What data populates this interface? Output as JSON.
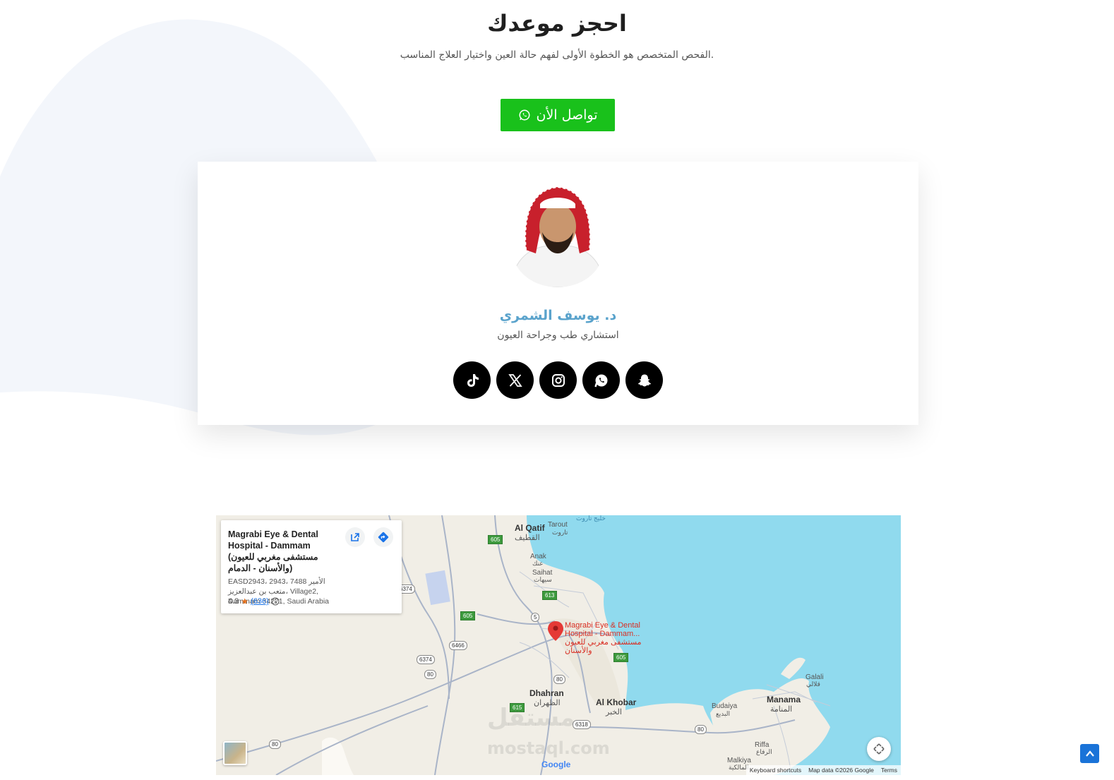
{
  "booking": {
    "title": "احجز موعدك",
    "subtitle": ".الفحص المتخصص هو الخطوة الأولى لفهم حالة العين واختيار العلاج المناسب",
    "cta_label": "تواصل الأن"
  },
  "doctor": {
    "name": "د. يوسف الشمري",
    "specialty": "استشاري طب وجراحة العيون",
    "socials": [
      {
        "icon": "tiktok-icon"
      },
      {
        "icon": "x-icon"
      },
      {
        "icon": "instagram-icon"
      },
      {
        "icon": "whatsapp-icon"
      },
      {
        "icon": "snapchat-icon"
      }
    ]
  },
  "map": {
    "place_card": {
      "name": "Magrabi Eye & Dental Hospital - Dammam (مستشفى مغربي للعيون والأسنان - الدمام)",
      "address": "EASD2943، 2943، 7488 الأمير متعب بن عبدالعزيز، Village2, Dammam 34271, Saudi Arabia",
      "rating": "4.3",
      "reviews": "(636)"
    },
    "pin_label": "Magrabi Eye & Dental Hospital - Dammam... مستشفى مغربي للعيون والأسنان",
    "labels": {
      "al_qatif": "Al Qatif",
      "al_qatif_ar": "القطيف",
      "tarout": "Tarout",
      "tarout_ar": "تاروت",
      "tarout_bay_ar": "خليج تاروت",
      "anak": "Anak",
      "anak_ar": "عنك",
      "saihat": "Saihat",
      "saihat_ar": "سيهات",
      "dhahran": "Dhahran",
      "dhahran_ar": "الظهران",
      "al_khobar": "Al Khobar",
      "al_khobar_ar": "الخبر",
      "budaiya": "Budaiya",
      "budaiya_ar": "البديع",
      "manama": "Manama",
      "manama_ar": "المنامة",
      "galali": "Galali",
      "galali_ar": "قلالي",
      "riffa": "Riffa",
      "riffa_ar": "الرفاع",
      "malkiya": "Malkiya",
      "malkiya_ar": "المالكية"
    },
    "shields": {
      "r605a": "605",
      "r605b": "605",
      "r605c": "605",
      "r613": "613",
      "r5": "5",
      "r6374a": "6374",
      "r6374b": "6374",
      "r6466": "6466",
      "r80a": "80",
      "r80b": "80",
      "r80c": "80",
      "r80d": "80",
      "r615": "615",
      "r6318": "6318"
    },
    "google": "Google",
    "footer": {
      "shortcuts": "Keyboard shortcuts",
      "data": "Map data ©2026 Google",
      "terms": "Terms"
    },
    "watermark": "مستقل",
    "watermark_url": "mostaql.com"
  }
}
